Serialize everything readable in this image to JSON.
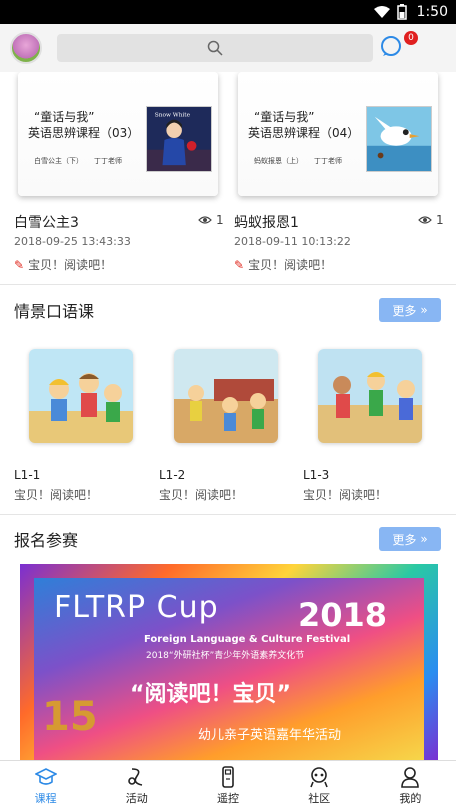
{
  "status_bar": {
    "time": "1:50"
  },
  "header": {
    "badge_count": "0",
    "icons": [
      "avatar",
      "search-icon",
      "message-icon"
    ]
  },
  "top_cards": [
    {
      "title_line1": "“童话与我”",
      "title_line2": "英语思辨课程（03）",
      "subtitle": "白雪公主（下）",
      "teacher": "丁丁老师",
      "name": "白雪公主3",
      "views": "1",
      "date": "2018-09-25 13:43:33",
      "slogan": "宝贝！阅读吧！"
    },
    {
      "title_line1": "“童话与我”",
      "title_line2": "英语思辨课程（04）",
      "subtitle": "蚂蚁报恩（上）",
      "teacher": "丁丁老师",
      "name": "蚂蚁报恩1",
      "views": "1",
      "date": "2018-09-11 10:13:22",
      "slogan": "宝贝！阅读吧！"
    }
  ],
  "section_oral": {
    "title": "情景口语课",
    "more": "更多",
    "lessons": [
      {
        "code": "L1-1",
        "slogan": "宝贝！阅读吧！"
      },
      {
        "code": "L1-2",
        "slogan": "宝贝！阅读吧！"
      },
      {
        "code": "L1-3",
        "slogan": "宝贝！阅读吧！"
      }
    ]
  },
  "section_contest": {
    "title": "报名参赛",
    "more": "更多",
    "banner": {
      "title": "FLTRP Cup",
      "year": "2018",
      "festival": "Foreign Language & Culture Festival",
      "festival_cn": "2018“外研社杯”青少年外语素养文化节",
      "slogan": "“阅读吧！宝贝”",
      "sub": "幼儿亲子英语嘉年华活动",
      "number": "15"
    }
  },
  "tabbar": [
    {
      "label": "课程",
      "icon": "hat-icon",
      "active": true
    },
    {
      "label": "活动",
      "icon": "activity-icon",
      "active": false
    },
    {
      "label": "遥控",
      "icon": "remote-icon",
      "active": false
    },
    {
      "label": "社区",
      "icon": "community-icon",
      "active": false
    },
    {
      "label": "我的",
      "icon": "user-icon",
      "active": false
    }
  ],
  "colors": {
    "accent": "#2d8ae6",
    "more_button": "#88b6f3",
    "badge": "#e02020",
    "pencil": "#e0281e"
  }
}
